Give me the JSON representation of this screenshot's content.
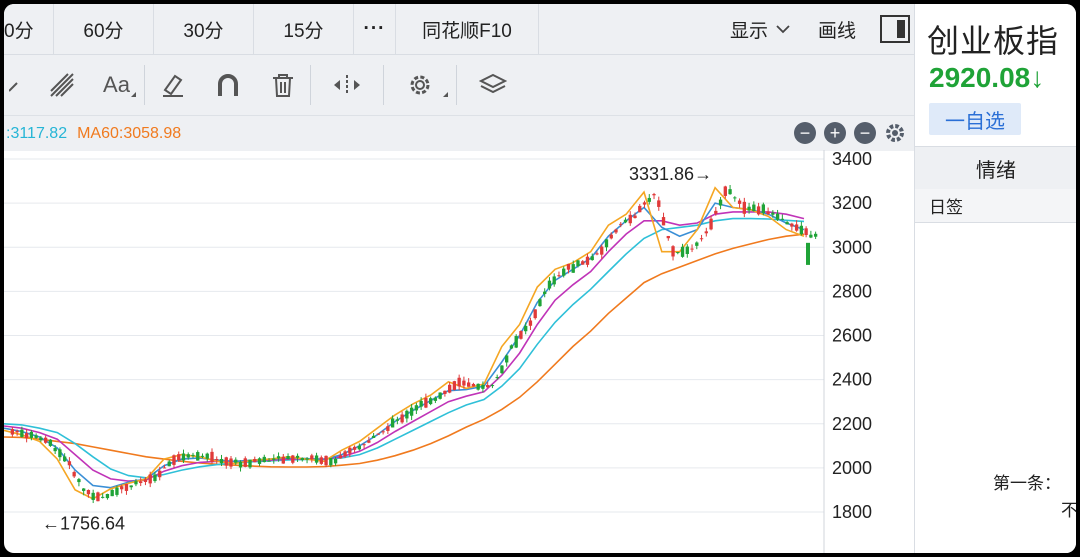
{
  "tabs": [
    "0分",
    "60分",
    "30分",
    "15分",
    "···",
    "同花顺F10"
  ],
  "toolbar_right": {
    "display": "显示",
    "draw_line": "画线"
  },
  "ma": {
    "ma_a": ":3117.82",
    "ma_b": "MA60:3058.98"
  },
  "colors": {
    "up": "#e03a3a",
    "down": "#1fa337",
    "ma5": "#f5a623",
    "ma10": "#3a8fd6",
    "ma20": "#c034b8",
    "ma30": "#2fc0d8",
    "ma60": "#f07a1e"
  },
  "icons": [
    "draw-icon",
    "fork-icon",
    "text-aa-icon",
    "eraser-icon",
    "magnet-icon",
    "trash-icon",
    "move-icon",
    "settings-icon",
    "layers-icon"
  ],
  "toolbar_labels": {
    "text": "Aa"
  },
  "right_panel": {
    "title": "创业板指",
    "price": "2920.08↓",
    "add_fav": "一自选",
    "tab": "情绪",
    "subtab": "日签",
    "first": "第一条：",
    "no": "不"
  },
  "chart_data": {
    "type": "candlestick",
    "yticks": [
      3400,
      3200,
      3000,
      2800,
      2600,
      2400,
      2200,
      2000,
      1800
    ],
    "ylim": [
      1700,
      3420
    ],
    "annotations": [
      {
        "label": "3331.86→",
        "value": 3331.86
      },
      {
        "label": "←1756.64",
        "value": 1756.64
      }
    ],
    "ma5_path": [
      2170,
      2150,
      2120,
      2040,
      1900,
      1860,
      1905,
      1930,
      1950,
      2040,
      2060,
      2050,
      2030,
      2020,
      2035,
      2040,
      2050,
      2040,
      2030,
      2080,
      2120,
      2180,
      2240,
      2290,
      2330,
      2390,
      2360,
      2380,
      2550,
      2650,
      2820,
      2900,
      2930,
      2980,
      3100,
      3150,
      3250,
      2980,
      2980,
      3080,
      3270,
      3180,
      3170,
      3140,
      3080,
      3050
    ],
    "ma10_path": [
      2180,
      2165,
      2140,
      2090,
      1990,
      1920,
      1910,
      1935,
      1950,
      2010,
      2040,
      2045,
      2035,
      2030,
      2035,
      2040,
      2045,
      2042,
      2038,
      2060,
      2100,
      2150,
      2210,
      2260,
      2305,
      2350,
      2355,
      2370,
      2480,
      2600,
      2750,
      2850,
      2900,
      2950,
      3050,
      3120,
      3180,
      3090,
      3050,
      3080,
      3200,
      3180,
      3170,
      3150,
      3110,
      3080
    ],
    "ma20_path": [
      2190,
      2180,
      2160,
      2130,
      2060,
      1990,
      1950,
      1940,
      1945,
      1985,
      2010,
      2025,
      2030,
      2030,
      2032,
      2035,
      2040,
      2040,
      2040,
      2050,
      2075,
      2115,
      2165,
      2210,
      2255,
      2300,
      2325,
      2345,
      2420,
      2520,
      2650,
      2760,
      2830,
      2890,
      2980,
      3060,
      3120,
      3120,
      3100,
      3110,
      3150,
      3160,
      3160,
      3160,
      3150,
      3130
    ],
    "ma30_path": [
      2200,
      2195,
      2180,
      2160,
      2110,
      2050,
      1995,
      1965,
      1955,
      1970,
      1990,
      2005,
      2015,
      2022,
      2028,
      2032,
      2036,
      2038,
      2040,
      2045,
      2060,
      2090,
      2130,
      2170,
      2210,
      2250,
      2285,
      2310,
      2370,
      2450,
      2560,
      2660,
      2740,
      2810,
      2890,
      2970,
      3040,
      3080,
      3090,
      3100,
      3120,
      3130,
      3130,
      3128,
      3122,
      3117
    ],
    "ma60_path": [
      2140,
      2138,
      2130,
      2120,
      2110,
      2095,
      2080,
      2065,
      2050,
      2040,
      2030,
      2022,
      2016,
      2012,
      2008,
      2005,
      2004,
      2004,
      2006,
      2012,
      2020,
      2035,
      2055,
      2080,
      2110,
      2145,
      2185,
      2220,
      2265,
      2320,
      2390,
      2470,
      2550,
      2620,
      2700,
      2770,
      2840,
      2880,
      2910,
      2940,
      2970,
      2995,
      3015,
      3035,
      3050,
      3059
    ]
  }
}
